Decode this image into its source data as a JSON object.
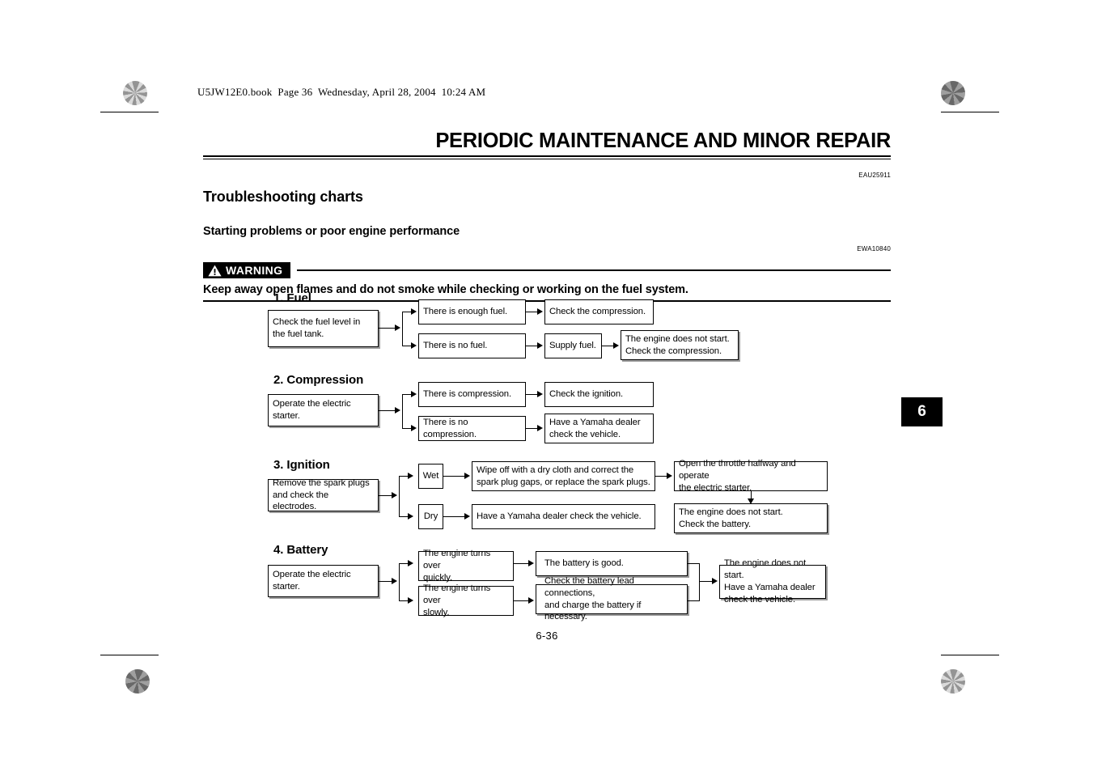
{
  "page": {
    "book_slug": "U5JW12E0.book  Page 36  Wednesday, April 28, 2004  10:24 AM",
    "chapter_title": "PERIODIC MAINTENANCE AND MINOR REPAIR",
    "page_number": "6-36",
    "chapter_tab": "6"
  },
  "section": {
    "heading": "Troubleshooting charts",
    "heading_code": "EAU25911",
    "subheading": "Starting problems or poor engine performance",
    "warning_code": "EWA10840"
  },
  "warning": {
    "badge_label": "WARNING",
    "text": "Keep away open flames and do not smoke while checking or working on the fuel system."
  },
  "charts": [
    {
      "title": "1. Fuel",
      "start": "Check the fuel level in\nthe fuel tank.",
      "branches": [
        {
          "condition": "There is enough fuel.",
          "steps": [
            "Check the compression."
          ]
        },
        {
          "condition": "There is no fuel.",
          "steps": [
            "Supply fuel.",
            "The engine does not start.\nCheck the compression."
          ]
        }
      ]
    },
    {
      "title": "2. Compression",
      "start": "Operate the electric starter.",
      "branches": [
        {
          "condition": "There is compression.",
          "steps": [
            "Check the ignition."
          ]
        },
        {
          "condition": "There is no compression.",
          "steps": [
            "Have a Yamaha dealer\ncheck the vehicle."
          ]
        }
      ]
    },
    {
      "title": "3. Ignition",
      "start": "Remove the spark plugs\nand check the electrodes.",
      "branches": [
        {
          "condition": "Wet",
          "steps": [
            "Wipe off with a dry cloth and correct the\nspark plug gaps, or replace the spark plugs.",
            "Open the throttle halfway and operate\nthe electric starter.",
            "The engine does not start.\nCheck the battery."
          ]
        },
        {
          "condition": "Dry",
          "steps": [
            "Have a Yamaha dealer check the vehicle."
          ]
        }
      ]
    },
    {
      "title": "4. Battery",
      "start": "Operate the electric starter.",
      "branches": [
        {
          "condition": "The engine turns over\nquickly.",
          "steps": [
            "The battery is good."
          ]
        },
        {
          "condition": "The engine turns over\nslowly.",
          "steps": [
            "Check the battery lead connections,\nand charge the battery if necessary."
          ]
        }
      ],
      "merge": "The engine does not start.\nHave a Yamaha dealer\ncheck the vehicle."
    }
  ]
}
